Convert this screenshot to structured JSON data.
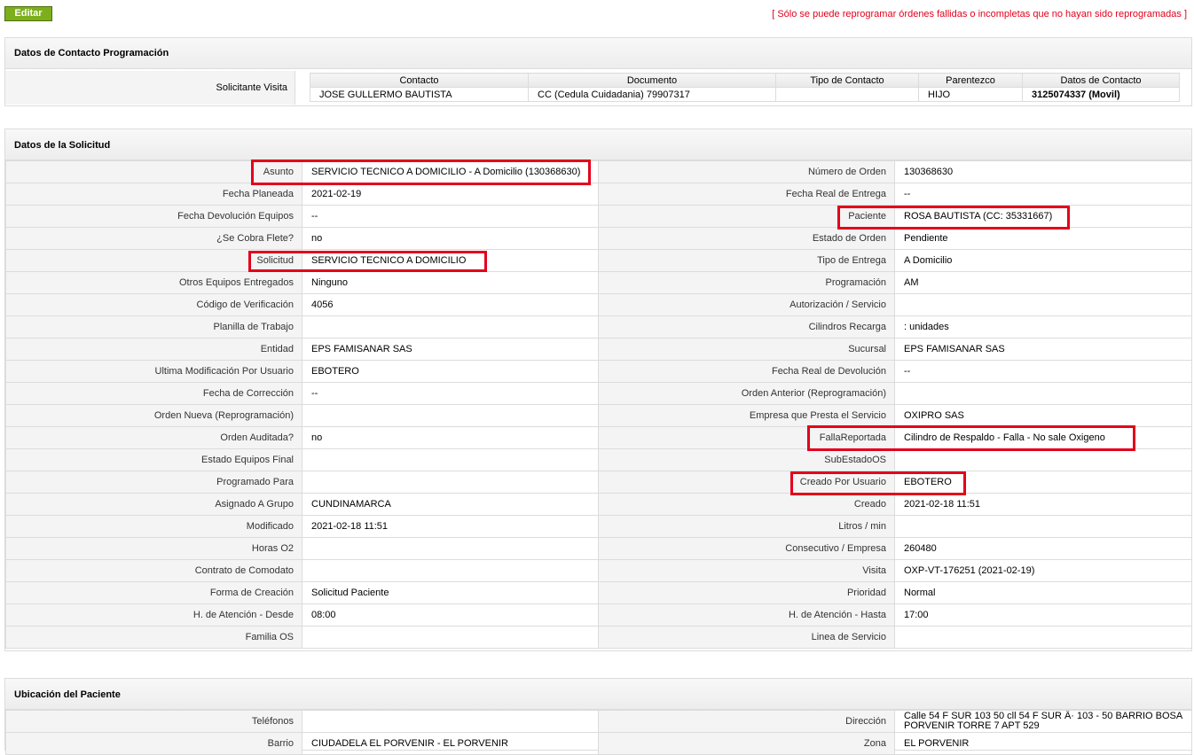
{
  "toolbar": {
    "edit_label": "Editar"
  },
  "notice": "[ Sólo se puede reprogramar órdenes fallidas o incompletas que no hayan sido reprogramadas ]",
  "contact_section": {
    "title": "Datos de Contacto Programación",
    "row_label": "Solicitante Visita",
    "headers": [
      "Contacto",
      "Documento",
      "Tipo de Contacto",
      "Parentezco",
      "Datos de Contacto"
    ],
    "row": [
      "JOSE GULLERMO BAUTISTA",
      "CC (Cedula Cuidadania) 79907317",
      "",
      "HIJO",
      "3125074337 (Movil)"
    ]
  },
  "request_section": {
    "title": "Datos de la Solicitud",
    "rows": [
      {
        "l1": "Asunto",
        "v1": "SERVICIO TECNICO A DOMICILIO - A Domicilio (130368630)",
        "l2": "Número de Orden",
        "v2": "130368630"
      },
      {
        "l1": "Fecha Planeada",
        "v1": "2021-02-19",
        "l2": "Fecha Real de Entrega",
        "v2": "--"
      },
      {
        "l1": "Fecha Devolución Equipos",
        "v1": "--",
        "l2": "Paciente",
        "v2": "ROSA BAUTISTA (CC: 35331667)"
      },
      {
        "l1": "¿Se Cobra Flete?",
        "v1": "no",
        "l2": "Estado de Orden",
        "v2": "Pendiente"
      },
      {
        "l1": "Solicitud",
        "v1": "SERVICIO TECNICO A DOMICILIO",
        "l2": "Tipo de Entrega",
        "v2": "A Domicilio"
      },
      {
        "l1": "Otros Equipos Entregados",
        "v1": "Ninguno",
        "l2": "Programación",
        "v2": "AM"
      },
      {
        "l1": "Código de Verificación",
        "v1": "4056",
        "l2": "Autorización / Servicio",
        "v2": ""
      },
      {
        "l1": "Planilla de Trabajo",
        "v1": "",
        "l2": "Cilindros Recarga",
        "v2": ": unidades"
      },
      {
        "l1": "Entidad",
        "v1": "EPS FAMISANAR SAS",
        "l2": "Sucursal",
        "v2": "EPS FAMISANAR SAS"
      },
      {
        "l1": "Ultima Modificación Por Usuario",
        "v1": "EBOTERO",
        "l2": "Fecha Real de Devolución",
        "v2": "--"
      },
      {
        "l1": "Fecha de Corrección",
        "v1": "--",
        "l2": "Orden Anterior (Reprogramación)",
        "v2": ""
      },
      {
        "l1": "Orden Nueva (Reprogramación)",
        "v1": "",
        "l2": "Empresa que Presta el Servicio",
        "v2": "OXIPRO SAS"
      },
      {
        "l1": "Orden Auditada?",
        "v1": "no",
        "l2": "FallaReportada",
        "v2": "Cilindro de Respaldo - Falla - No sale Oxigeno"
      },
      {
        "l1": "Estado Equipos Final",
        "v1": "",
        "l2": "SubEstadoOS",
        "v2": ""
      },
      {
        "l1": "Programado Para",
        "v1": "",
        "l2": "Creado Por Usuario",
        "v2": "EBOTERO"
      },
      {
        "l1": "Asignado A Grupo",
        "v1": "CUNDINAMARCA",
        "l2": "Creado",
        "v2": "2021-02-18 11:51"
      },
      {
        "l1": "Modificado",
        "v1": "2021-02-18 11:51",
        "l2": "Litros / min",
        "v2": ""
      },
      {
        "l1": "Horas O2",
        "v1": "",
        "l2": "Consecutivo / Empresa",
        "v2": "260480"
      },
      {
        "l1": "Contrato de Comodato",
        "v1": "",
        "l2": "Visita",
        "v2": "OXP-VT-176251 (2021-02-19)"
      },
      {
        "l1": "Forma de Creación",
        "v1": "Solicitud Paciente",
        "l2": "Prioridad",
        "v2": "Normal"
      },
      {
        "l1": "H. de Atención - Desde",
        "v1": "08:00",
        "l2": "H. de Atención - Hasta",
        "v2": "17:00"
      },
      {
        "l1": "Familia OS",
        "v1": "",
        "l2": "Linea de Servicio",
        "v2": ""
      }
    ]
  },
  "location_section": {
    "title": "Ubicación del Paciente",
    "rows": [
      {
        "l1": "Teléfonos",
        "v1": "",
        "l2": "Dirección",
        "v2": "Calle 54 F SUR 103 50 cll 54 F SUR Â· 103 - 50 BARRIO BOSA PORVENIR TORRE 7 APT 529"
      },
      {
        "l1": "Barrio",
        "v1": "CIUDADELA EL PORVENIR - EL PORVENIR",
        "l2": "Zona",
        "v2": "EL PORVENIR"
      }
    ]
  },
  "highlight_color": "#e3001b"
}
